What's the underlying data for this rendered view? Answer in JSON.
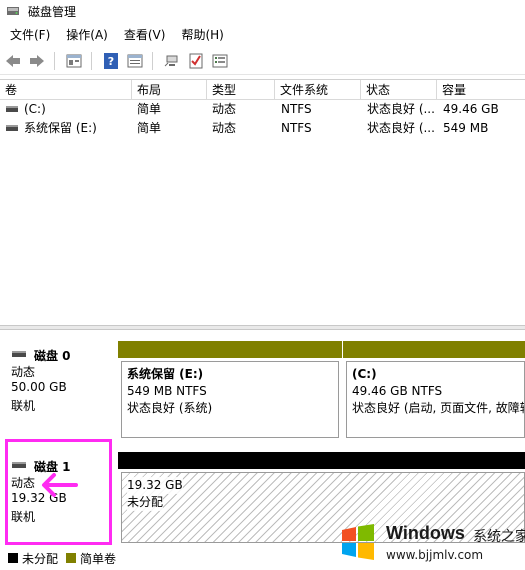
{
  "window": {
    "title": "磁盘管理"
  },
  "menu": [
    "文件(F)",
    "操作(A)",
    "查看(V)",
    "帮助(H)"
  ],
  "toolbar": [
    "back-icon",
    "forward-icon",
    "up-icon",
    "help-icon",
    "properties-icon",
    "connect-icon",
    "check-icon",
    "list-icon"
  ],
  "volume_list": {
    "columns": [
      "卷",
      "布局",
      "类型",
      "文件系统",
      "状态",
      "容量"
    ],
    "rows": [
      {
        "volume": "(C:)",
        "layout": "简单",
        "type": "动态",
        "fs": "NTFS",
        "status": "状态良好 (...",
        "capacity": "49.46 GB"
      },
      {
        "volume": "系统保留 (E:)",
        "layout": "简单",
        "type": "动态",
        "fs": "NTFS",
        "status": "状态良好 (...",
        "capacity": "549 MB"
      }
    ]
  },
  "disks": [
    {
      "name": "磁盘 0",
      "type": "动态",
      "size": "50.00 GB",
      "state": "联机",
      "partitions": [
        {
          "title": "系统保留  (E:)",
          "size": "549 MB NTFS",
          "status": "状态良好 (系统)"
        },
        {
          "title": "(C:)",
          "size": "49.46 GB NTFS",
          "status": "状态良好 (启动, 页面文件, 故障转"
        }
      ]
    },
    {
      "name": "磁盘 1",
      "type": "动态",
      "size": "19.32 GB",
      "state": "联机",
      "unallocated": {
        "size": "19.32 GB",
        "label": "未分配"
      }
    }
  ],
  "legend": [
    {
      "label": "未分配",
      "color": "#000000"
    },
    {
      "label": "简单卷",
      "color": "#808000"
    }
  ],
  "colors": {
    "simple_volume": "#808000",
    "unallocated": "#000000",
    "annotation": "#ff2bf2"
  },
  "watermark": {
    "brand": "Windows",
    "text": "系统之家",
    "url": "www.bjjmlv.com"
  }
}
